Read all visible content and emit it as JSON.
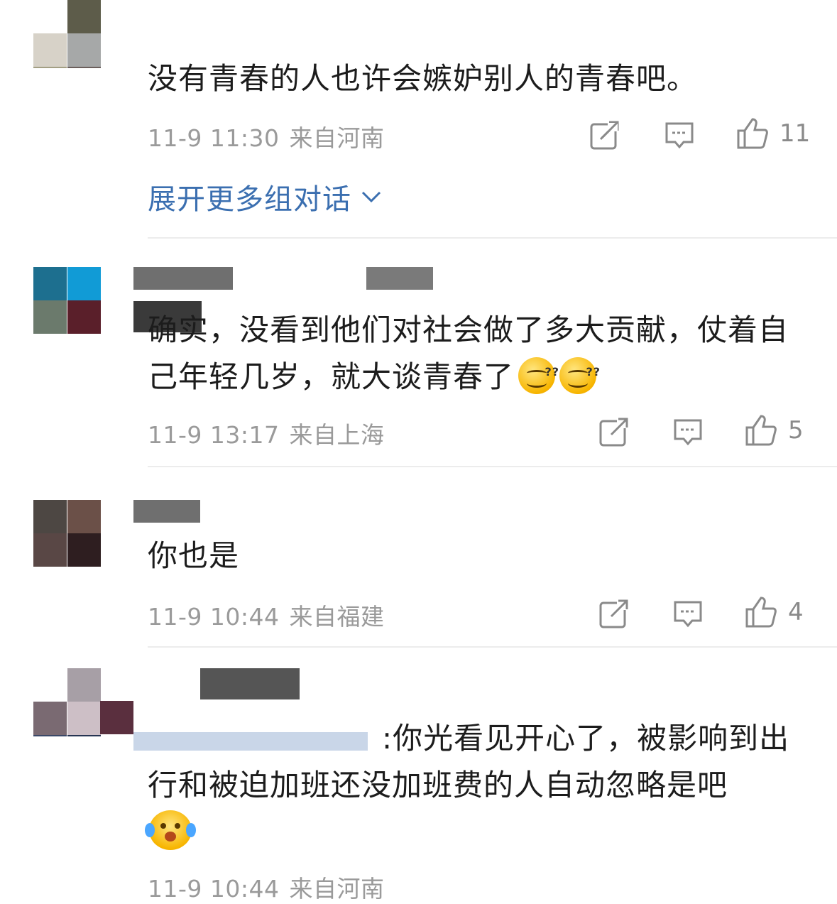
{
  "comments": [
    {
      "text": "没有青春的人也许会嫉妒别人的青春吧。",
      "time": "11-9 11:30",
      "location": "来自河南",
      "likes": "11",
      "expand_label": "展开更多组对话"
    },
    {
      "text": "确实，没看到他们对社会做了多大贡献，仗着自己年轻几岁，就大谈青春了",
      "time": "11-9 13:17",
      "location": "来自上海",
      "likes": "5"
    },
    {
      "text": "你也是",
      "time": "11-9 10:44",
      "location": "来自福建",
      "likes": "4"
    },
    {
      "text": ":你光看见开心了，被影响到出行和被迫加班还没加班费的人自动忽略是吧",
      "time": "11-9 10:44",
      "location": "来自河南"
    }
  ],
  "icons": {
    "repost": "repost-icon",
    "comment": "comment-icon",
    "like": "like-icon",
    "chevron": "chevron-down-icon"
  },
  "colors": {
    "link": "#3b6fb0",
    "meta": "#9a9a9a",
    "divider": "#ececec"
  }
}
